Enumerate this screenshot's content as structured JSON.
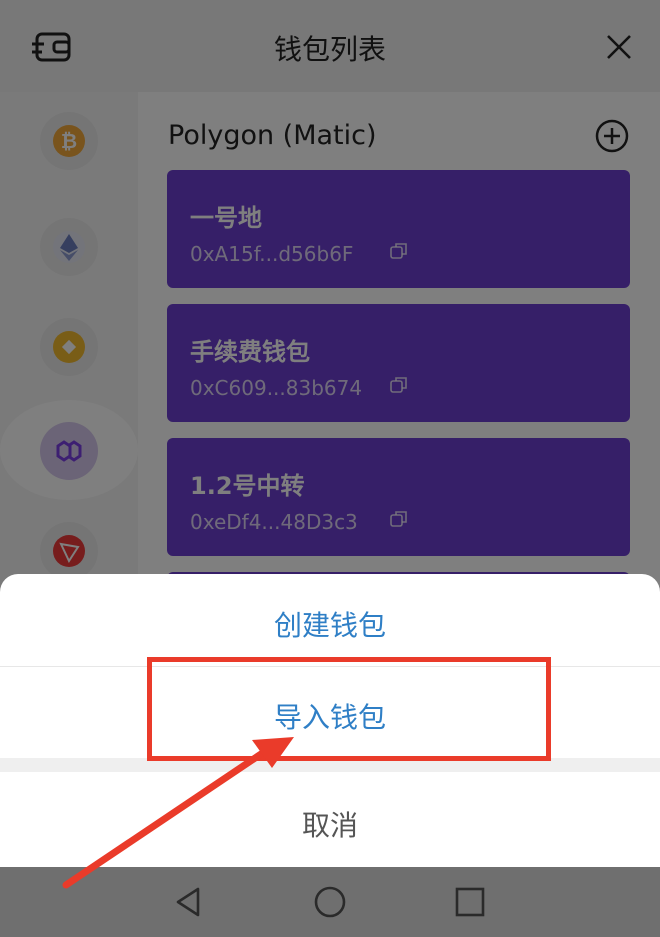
{
  "header": {
    "title": "钱包列表"
  },
  "network": {
    "title": "Polygon (Matic)"
  },
  "chains": [
    "bitcoin-icon",
    "ethereum-icon",
    "bnb-icon",
    "polygon-icon",
    "tron-icon"
  ],
  "wallets": [
    {
      "name": "一号地",
      "address": "0xA15f...d56b6F"
    },
    {
      "name": "手续费钱包",
      "address": "0xC609...83b674"
    },
    {
      "name": "1.2号中转",
      "address": "0xeDf4...48D3c3"
    }
  ],
  "sheet": {
    "create_label": "创建钱包",
    "import_label": "导入钱包",
    "cancel_label": "取消"
  },
  "colors": {
    "card": "#6c3fd0",
    "sheet_text": "#2f7fc6",
    "highlight": "#ea3b2a"
  }
}
